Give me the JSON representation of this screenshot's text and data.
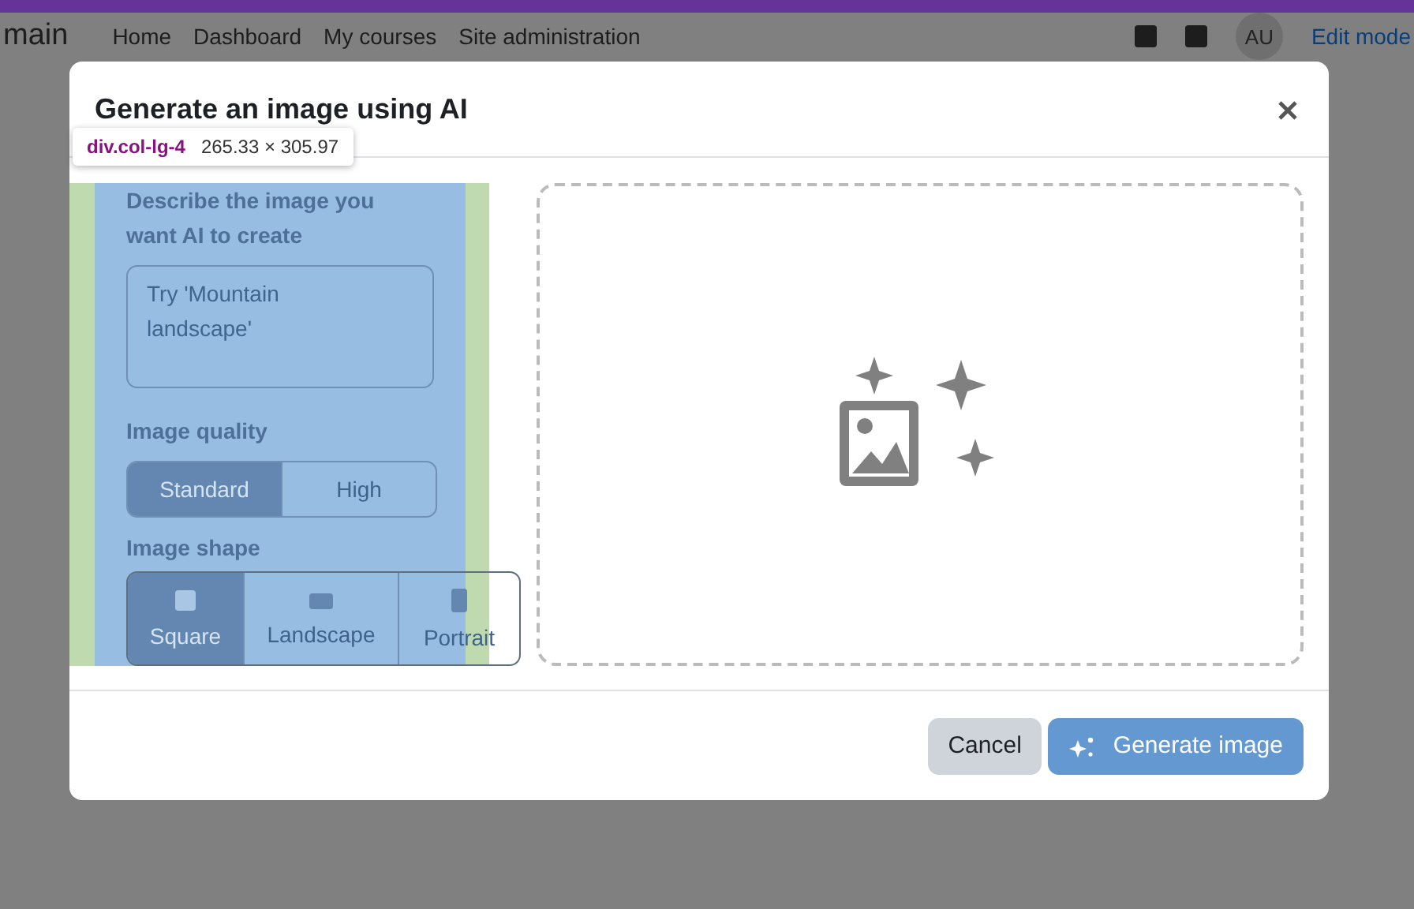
{
  "background_page": {
    "site_name": "main",
    "nav": [
      "Home",
      "Dashboard",
      "My courses",
      "Site administration"
    ],
    "user_initials": "AU",
    "edit_mode": "Edit mode"
  },
  "devtools_tooltip": {
    "selector": "div.col-lg-4",
    "size": "265.33 × 305.97"
  },
  "modal": {
    "title": "Generate an image using AI",
    "prompt": {
      "label": "Describe the image you want AI to create",
      "placeholder": "Try 'Mountain landscape'"
    },
    "quality": {
      "label": "Image quality",
      "options": [
        {
          "label": "Standard",
          "selected": true
        },
        {
          "label": "High",
          "selected": false
        }
      ]
    },
    "shape": {
      "label": "Image shape",
      "options": [
        {
          "label": "Square",
          "kind": "square",
          "selected": true
        },
        {
          "label": "Landscape",
          "kind": "landscape",
          "selected": false
        },
        {
          "label": "Portrait",
          "kind": "portrait",
          "selected": false
        }
      ]
    },
    "buttons": [
      {
        "label": "Cancel",
        "kind": "secondary"
      },
      {
        "label": "Generate image",
        "kind": "primary"
      }
    ]
  }
}
